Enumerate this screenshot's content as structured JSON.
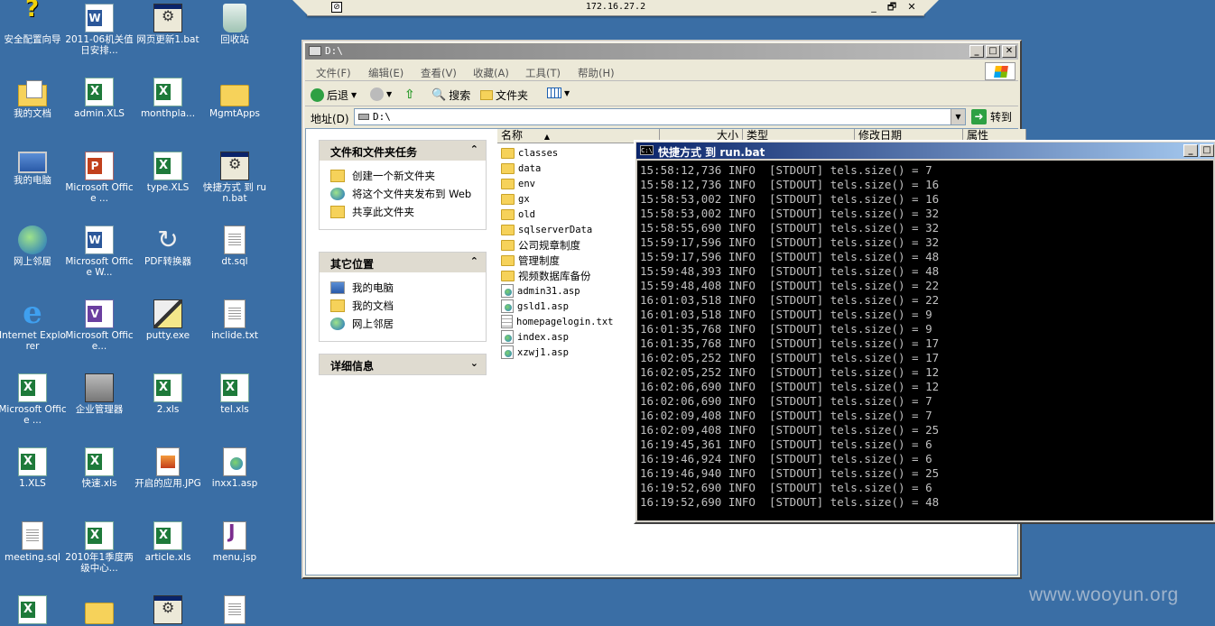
{
  "rdp": {
    "title": "172.16.27.2",
    "pin": "⊘",
    "min": "_",
    "restore": "🗗",
    "close": "✕"
  },
  "desktop_icons": [
    {
      "label": "安全配置向导",
      "icon": "help-icon"
    },
    {
      "label": "2011-06机关值日安排...",
      "icon": "word-doc-icon"
    },
    {
      "label": "网页更新1.bat",
      "icon": "batch-file-icon"
    },
    {
      "label": "回收站",
      "icon": "recycle-bin-icon"
    },
    {
      "label": "我的文档",
      "icon": "my-documents-icon"
    },
    {
      "label": "admin.XLS",
      "icon": "excel-file-icon"
    },
    {
      "label": "monthpla...",
      "icon": "excel-file-icon"
    },
    {
      "label": "MgmtApps",
      "icon": "folder-icon"
    },
    {
      "label": "我的电脑",
      "icon": "my-computer-icon"
    },
    {
      "label": "Microsoft Office ...",
      "icon": "powerpoint-icon"
    },
    {
      "label": "type.XLS",
      "icon": "excel-file-icon"
    },
    {
      "label": "快捷方式 到 run.bat",
      "icon": "batch-file-icon"
    },
    {
      "label": "网上邻居",
      "icon": "network-icon"
    },
    {
      "label": "Microsoft Office W...",
      "icon": "word-icon"
    },
    {
      "label": "PDF转换器",
      "icon": "pdf-converter-icon"
    },
    {
      "label": "dt.sql",
      "icon": "text-file-icon"
    },
    {
      "label": "Internet Explorer",
      "icon": "internet-explorer-icon"
    },
    {
      "label": "Microsoft Office...",
      "icon": "visio-icon"
    },
    {
      "label": "putty.exe",
      "icon": "putty-icon"
    },
    {
      "label": "inclide.txt",
      "icon": "text-file-icon"
    },
    {
      "label": "Microsoft Office ...",
      "icon": "excel-icon"
    },
    {
      "label": "企业管理器",
      "icon": "enterprise-manager-icon"
    },
    {
      "label": "2.xls",
      "icon": "excel-file-icon"
    },
    {
      "label": "tel.xls",
      "icon": "excel-file-icon"
    },
    {
      "label": "1.XLS",
      "icon": "excel-file-icon"
    },
    {
      "label": "快速.xls",
      "icon": "excel-file-icon"
    },
    {
      "label": "开启的应用.JPG",
      "icon": "image-file-icon"
    },
    {
      "label": "inxx1.asp",
      "icon": "asp-file-icon"
    },
    {
      "label": "meeting.sql",
      "icon": "text-file-icon"
    },
    {
      "label": "2010年1季度两级中心...",
      "icon": "excel-file-icon"
    },
    {
      "label": "article.xls",
      "icon": "excel-file-icon"
    },
    {
      "label": "menu.jsp",
      "icon": "jsp-file-icon"
    }
  ],
  "explorer": {
    "title": "D:\\",
    "menu": [
      "文件(F)",
      "编辑(E)",
      "查看(V)",
      "收藏(A)",
      "工具(T)",
      "帮助(H)"
    ],
    "toolbar": {
      "back": "后退",
      "search": "搜索",
      "folders": "文件夹"
    },
    "address": {
      "label": "地址(D)",
      "value": "D:\\",
      "go": "转到"
    },
    "tasks": {
      "file_tasks_title": "文件和文件夹任务",
      "file_tasks": [
        "创建一个新文件夹",
        "将这个文件夹发布到 Web",
        "共享此文件夹"
      ],
      "other_places_title": "其它位置",
      "other_places": [
        "我的电脑",
        "我的文档",
        "网上邻居"
      ],
      "details_title": "详细信息"
    },
    "columns": [
      "名称",
      "大小",
      "类型",
      "修改日期",
      "属性"
    ],
    "files": [
      {
        "name": "classes",
        "kind": "folder"
      },
      {
        "name": "data",
        "kind": "folder"
      },
      {
        "name": "env",
        "kind": "folder"
      },
      {
        "name": "gx",
        "kind": "folder"
      },
      {
        "name": "old",
        "kind": "folder"
      },
      {
        "name": "sqlserverData",
        "kind": "folder"
      },
      {
        "name": "公司规章制度",
        "kind": "folder"
      },
      {
        "name": "管理制度",
        "kind": "folder"
      },
      {
        "name": "视频数据库备份",
        "kind": "folder"
      },
      {
        "name": "admin31.asp",
        "kind": "asp"
      },
      {
        "name": "gsld1.asp",
        "kind": "asp"
      },
      {
        "name": "homepagelogin.txt",
        "kind": "txt"
      },
      {
        "name": "index.asp",
        "kind": "asp"
      },
      {
        "name": "xzwj1.asp",
        "kind": "asp"
      }
    ]
  },
  "console": {
    "title": "快捷方式 到 run.bat",
    "icon_text": "C:\\",
    "lines": [
      "15:58:12,736 INFO  [STDOUT] tels.size() = 7",
      "15:58:12,736 INFO  [STDOUT] tels.size() = 16",
      "15:58:53,002 INFO  [STDOUT] tels.size() = 16",
      "15:58:53,002 INFO  [STDOUT] tels.size() = 32",
      "15:58:55,690 INFO  [STDOUT] tels.size() = 32",
      "15:59:17,596 INFO  [STDOUT] tels.size() = 32",
      "15:59:17,596 INFO  [STDOUT] tels.size() = 48",
      "15:59:48,393 INFO  [STDOUT] tels.size() = 48",
      "15:59:48,408 INFO  [STDOUT] tels.size() = 22",
      "16:01:03,518 INFO  [STDOUT] tels.size() = 22",
      "16:01:03,518 INFO  [STDOUT] tels.size() = 9",
      "16:01:35,768 INFO  [STDOUT] tels.size() = 9",
      "16:01:35,768 INFO  [STDOUT] tels.size() = 17",
      "16:02:05,252 INFO  [STDOUT] tels.size() = 17",
      "16:02:05,252 INFO  [STDOUT] tels.size() = 12",
      "16:02:06,690 INFO  [STDOUT] tels.size() = 12",
      "16:02:06,690 INFO  [STDOUT] tels.size() = 7",
      "16:02:09,408 INFO  [STDOUT] tels.size() = 7",
      "16:02:09,408 INFO  [STDOUT] tels.size() = 25",
      "16:19:45,361 INFO  [STDOUT] tels.size() = 6",
      "16:19:46,924 INFO  [STDOUT] tels.size() = 6",
      "16:19:46,940 INFO  [STDOUT] tels.size() = 25",
      "16:19:52,690 INFO  [STDOUT] tels.size() = 6",
      "16:19:52,690 INFO  [STDOUT] tels.size() = 48"
    ]
  },
  "watermark": "www.wooyun.org",
  "colors": {
    "desktop": "#3a6ea5",
    "console_bg": "#000000",
    "console_text": "#c0c0c0",
    "title_active": "#0a246a"
  }
}
